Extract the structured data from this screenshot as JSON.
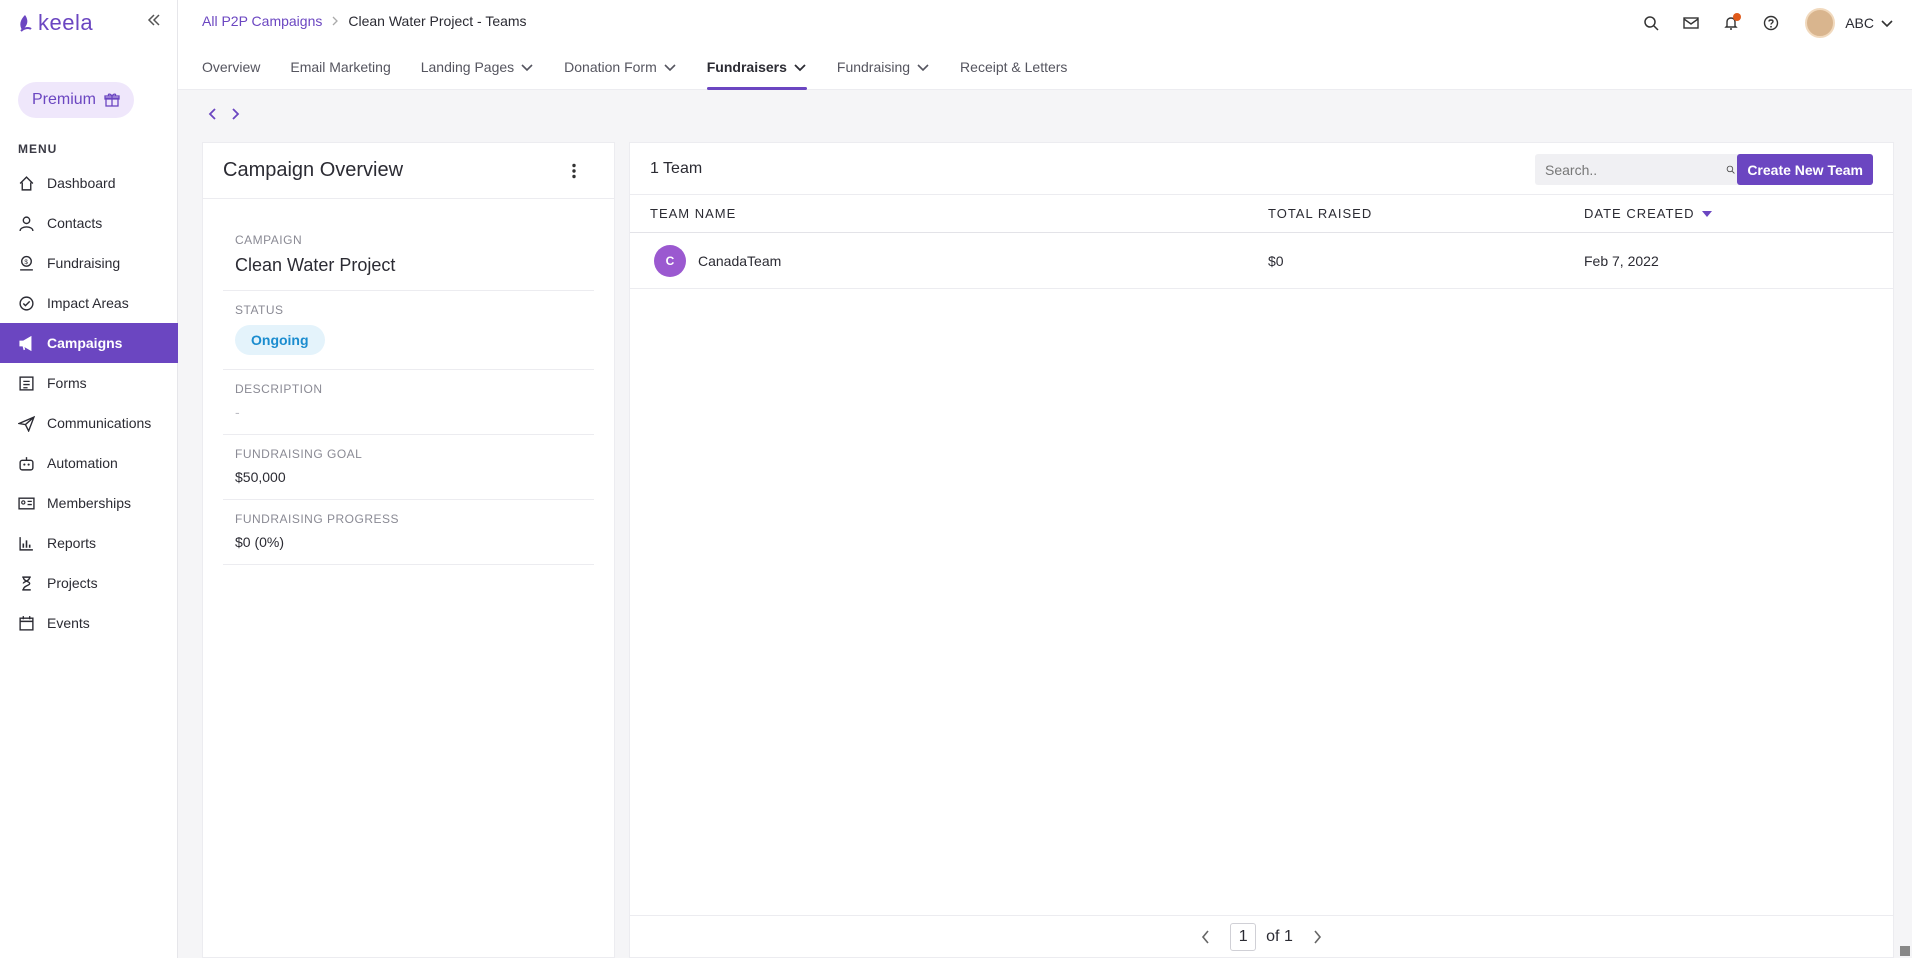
{
  "app": {
    "logo_text": "keela",
    "premium_label": "Premium",
    "menu_heading": "MENU"
  },
  "sidebar": {
    "items": [
      {
        "label": "Dashboard",
        "icon": "home-icon"
      },
      {
        "label": "Contacts",
        "icon": "user-icon"
      },
      {
        "label": "Fundraising",
        "icon": "fundraising-icon"
      },
      {
        "label": "Impact Areas",
        "icon": "impact-icon"
      },
      {
        "label": "Campaigns",
        "icon": "megaphone-icon",
        "active": true
      },
      {
        "label": "Forms",
        "icon": "form-icon"
      },
      {
        "label": "Communications",
        "icon": "paper-plane-icon"
      },
      {
        "label": "Automation",
        "icon": "robot-icon"
      },
      {
        "label": "Memberships",
        "icon": "id-card-icon"
      },
      {
        "label": "Reports",
        "icon": "chart-icon"
      },
      {
        "label": "Projects",
        "icon": "hourglass-icon"
      },
      {
        "label": "Events",
        "icon": "calendar-icon"
      }
    ]
  },
  "header": {
    "breadcrumb_parent": "All P2P Campaigns",
    "breadcrumb_current": "Clean Water Project - Teams",
    "user_name": "ABC"
  },
  "tabs": [
    {
      "label": "Overview",
      "dropdown": false
    },
    {
      "label": "Email Marketing",
      "dropdown": false
    },
    {
      "label": "Landing Pages",
      "dropdown": true
    },
    {
      "label": "Donation Form",
      "dropdown": true
    },
    {
      "label": "Fundraisers",
      "dropdown": true,
      "active": true
    },
    {
      "label": "Fundraising",
      "dropdown": true
    },
    {
      "label": "Receipt & Letters",
      "dropdown": false
    }
  ],
  "overview": {
    "title": "Campaign Overview",
    "campaign_label": "CAMPAIGN",
    "campaign_value": "Clean Water Project",
    "status_label": "STATUS",
    "status_value": "Ongoing",
    "description_label": "DESCRIPTION",
    "description_value": "-",
    "goal_label": "FUNDRAISING GOAL",
    "goal_value": "$50,000",
    "progress_label": "FUNDRAISING PROGRESS",
    "progress_value": "$0 (0%)"
  },
  "teams": {
    "count_label": "1 Team",
    "search_placeholder": "Search..",
    "create_button": "Create New Team",
    "columns": {
      "name": "TEAM NAME",
      "raised": "TOTAL RAISED",
      "created": "DATE CREATED"
    },
    "rows": [
      {
        "initial": "C",
        "name": "CanadaTeam",
        "raised": "$0",
        "created": "Feb 7, 2022"
      }
    ],
    "pager": {
      "current": "1",
      "of_label": "of 1"
    }
  },
  "colors": {
    "accent": "#6b46c1",
    "status_bg": "#e4f3fb",
    "status_text": "#1a8ccf",
    "team_avatar": "#9b59d0",
    "notification": "#e05a1a"
  }
}
